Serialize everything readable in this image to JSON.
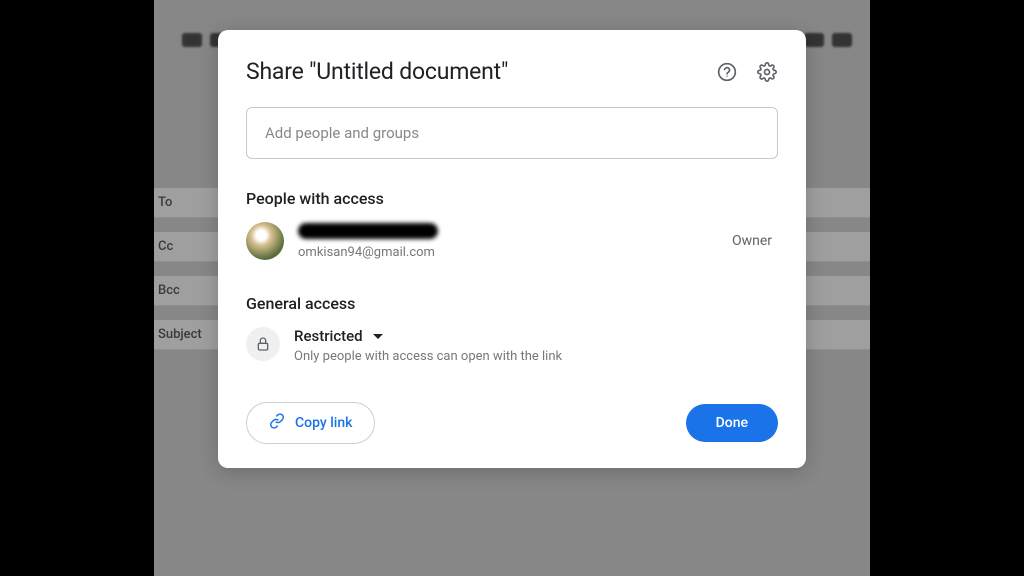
{
  "dialog": {
    "title": "Share \"Untitled document\"",
    "add_input_placeholder": "Add people and groups",
    "people_section_title": "People with access",
    "person": {
      "email": "omkisan94@gmail.com",
      "role": "Owner"
    },
    "general_section_title": "General access",
    "access_level": "Restricted",
    "access_description": "Only people with access can open with the link",
    "copy_link_label": "Copy link",
    "done_label": "Done"
  },
  "background": {
    "fields": [
      "To",
      "Cc",
      "Bcc",
      "Subject"
    ]
  }
}
